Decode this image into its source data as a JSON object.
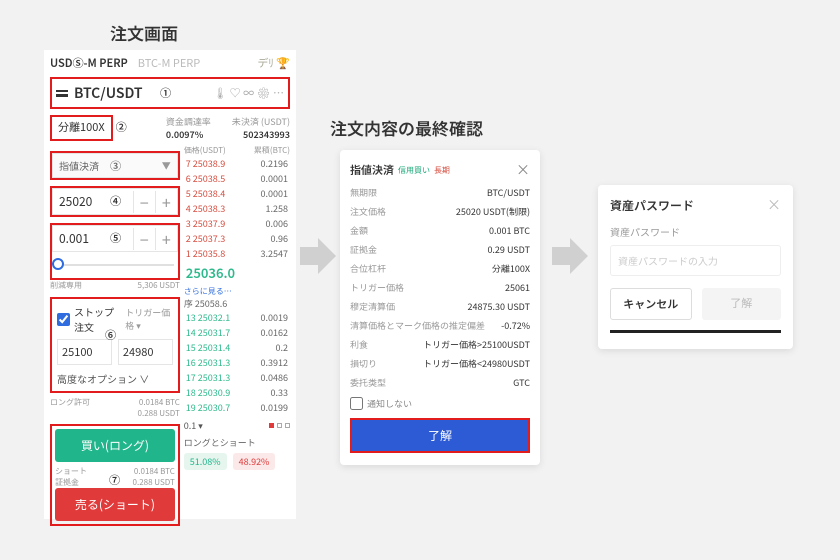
{
  "titles": {
    "order_screen": "注文画面",
    "confirm_screen": "注文内容の最終確認"
  },
  "order_panel": {
    "tabs": {
      "a": "USDⓈ-M PERP",
      "b": "BTC-M PERP",
      "icons": "デﾘ 🏆"
    },
    "pair_row": {
      "pair": "BTC/USDT",
      "badge": "①",
      "right_icons": "🌡 ♡ ∞ ⚙ ⋯"
    },
    "leverage": {
      "label": "分離100X",
      "badge": "②"
    },
    "rates": {
      "funding_label": "資金調達率",
      "funding_value": "0.0097%",
      "open_label": "未決済 (USDT)",
      "open_value": "502343993"
    },
    "ob_header": {
      "price": "価格(USDT)",
      "qty": "累積(BTC)"
    },
    "asks": [
      {
        "price": "7 25038.9",
        "qty": "0.2196"
      },
      {
        "price": "6 25038.5",
        "qty": "0.0001"
      },
      {
        "price": "5 25038.4",
        "qty": "0.0001"
      },
      {
        "price": "4 25038.3",
        "qty": "1.258"
      },
      {
        "price": "3 25037.9",
        "qty": "0.006"
      },
      {
        "price": "2 25037.3",
        "qty": "0.96"
      },
      {
        "price": "1 25035.8",
        "qty": "3.2547"
      }
    ],
    "bids": [
      {
        "price": "13 25032.1",
        "qty": "0.0019"
      },
      {
        "price": "14 25031.7",
        "qty": "0.0162"
      },
      {
        "price": "15 25031.4",
        "qty": "0.2"
      },
      {
        "price": "16 25031.3",
        "qty": "0.3912"
      },
      {
        "price": "17 25031.3",
        "qty": "0.0486"
      },
      {
        "price": "18 25030.9",
        "qty": "0.33"
      },
      {
        "price": "19 25030.7",
        "qty": "0.0199"
      }
    ],
    "mid_price": "25036.0",
    "mid_under": "序 25058.6",
    "more": "さらに見る…",
    "order_type": {
      "label": "指値決済",
      "badge": "③"
    },
    "price_field": {
      "value": "25020",
      "badge": "④"
    },
    "qty_field": {
      "value": "0.001",
      "badge": "⑤"
    },
    "reduce_line": {
      "label": "削減専用",
      "val": "5,306 USDT"
    },
    "stop_box": {
      "chk_label": "ストップ注文",
      "trigger": "トリガー価格 ▾",
      "tp": "25100",
      "sl": "24980",
      "adv": "高度なオプション ∨",
      "badge": "⑥"
    },
    "avail_long": {
      "label": "ロング許可",
      "btc": "0.0184 BTC",
      "usdt": "0.288 USDT"
    },
    "avail_short": {
      "label": "ショート\n証拠金",
      "btc": "0.0184 BTC",
      "usdt": "0.288 USDT"
    },
    "buttons": {
      "buy": "買い(ロング)",
      "sell": "売る(ショート)",
      "badge": "⑦"
    },
    "pct_line": {
      "tick": "0.1 ▾",
      "ls_label": "ロングとショート",
      "long": "51.08%",
      "short": "48.92%"
    }
  },
  "confirm": {
    "title": "指値決済",
    "tag1": "信用買い",
    "tag2": "長期",
    "rows": [
      {
        "k": "無期限",
        "v": "BTC/USDT"
      },
      {
        "k": "注文価格",
        "v": "25020 USDT(制限)"
      },
      {
        "k": "金額",
        "v": "0.001 BTC"
      },
      {
        "k": "証拠金",
        "v": "0.29 USDT"
      },
      {
        "k": "合位杠杆",
        "v": "分離100X"
      },
      {
        "k": "トリガー価格",
        "v": "25061"
      },
      {
        "k": "穆定清算価",
        "v": "24875.30 USDT"
      },
      {
        "k": "清算価格とマーク価格の推定偏差",
        "v": "-0.72%"
      },
      {
        "k": "利食",
        "v": "トリガー価格>25100USDT"
      },
      {
        "k": "損切り",
        "v": "トリガー価格<24980USDT"
      },
      {
        "k": "委托类型",
        "v": "GTC"
      }
    ],
    "dont_notify": "通知しない",
    "ok": "了解"
  },
  "password": {
    "title": "資産パスワード",
    "label": "資産パスワード",
    "placeholder": "資産パスワードの入力",
    "cancel": "キャンセル",
    "ok": "了解"
  }
}
